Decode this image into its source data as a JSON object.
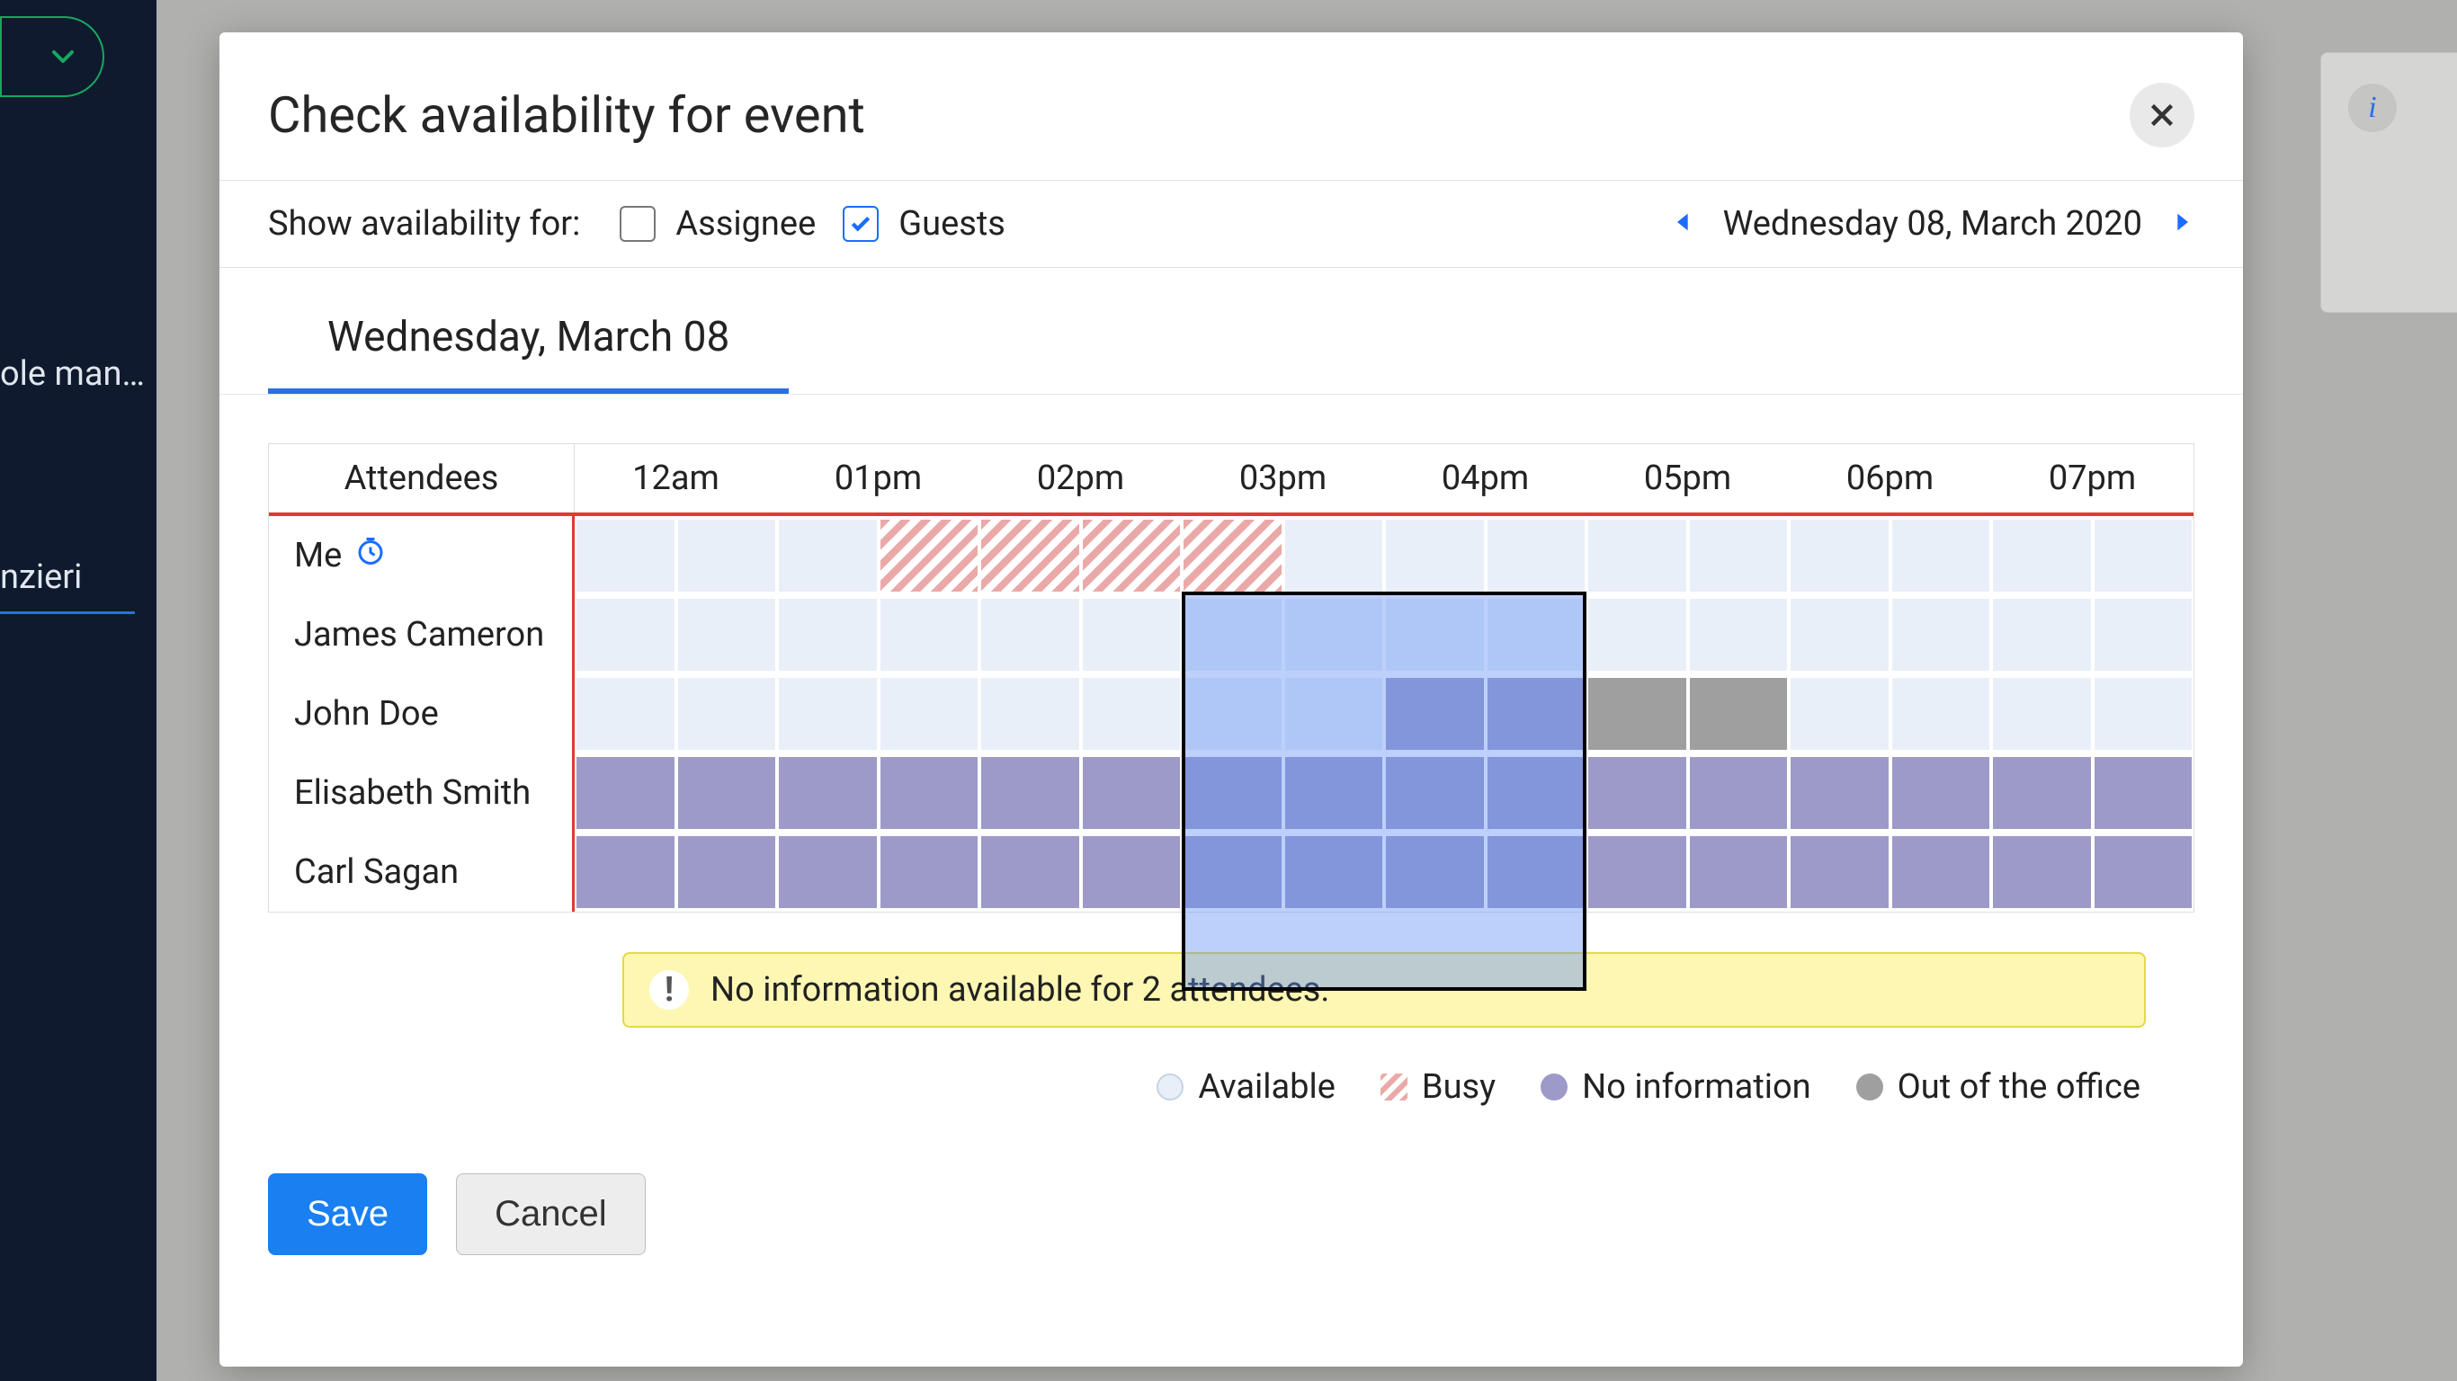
{
  "sidenav": {
    "item1_fragment": "ole man…",
    "item2_fragment": "nzieri"
  },
  "info_panel": {
    "icon": "info"
  },
  "modal": {
    "title": "Check availability for event",
    "filters": {
      "label": "Show availability for:",
      "assignee": {
        "label": "Assignee",
        "checked": false
      },
      "guests": {
        "label": "Guests",
        "checked": true
      }
    },
    "date_nav": {
      "date_long": "Wednesday 08, March 2020"
    },
    "tab": {
      "date_heading": "Wednesday, March 08"
    },
    "grid": {
      "attendees_header": "Attendees",
      "hours": [
        "12am",
        "01pm",
        "02pm",
        "03pm",
        "04pm",
        "05pm",
        "06pm",
        "07pm"
      ],
      "attendees": [
        {
          "name": "Me",
          "is_me": true,
          "cells": [
            "avail",
            "avail",
            "avail",
            "busy",
            "busy",
            "busy",
            "busy",
            "avail",
            "avail",
            "avail",
            "avail",
            "avail",
            "avail",
            "avail",
            "avail",
            "avail"
          ]
        },
        {
          "name": "James Cameron",
          "cells": [
            "avail",
            "avail",
            "avail",
            "avail",
            "avail",
            "avail",
            "avail",
            "avail",
            "avail",
            "avail",
            "avail",
            "avail",
            "avail",
            "avail",
            "avail",
            "avail"
          ]
        },
        {
          "name": "John Doe",
          "cells": [
            "avail",
            "avail",
            "avail",
            "avail",
            "avail",
            "avail",
            "avail",
            "avail",
            "noinfo",
            "noinfo",
            "out",
            "out",
            "avail",
            "avail",
            "avail",
            "avail"
          ]
        },
        {
          "name": "Elisabeth Smith",
          "cells": [
            "noinfo",
            "noinfo",
            "noinfo",
            "noinfo",
            "noinfo",
            "noinfo",
            "noinfo",
            "noinfo",
            "noinfo",
            "noinfo",
            "noinfo",
            "noinfo",
            "noinfo",
            "noinfo",
            "noinfo",
            "noinfo"
          ]
        },
        {
          "name": "Carl Sagan",
          "cells": [
            "noinfo",
            "noinfo",
            "noinfo",
            "noinfo",
            "noinfo",
            "noinfo",
            "noinfo",
            "noinfo",
            "noinfo",
            "noinfo",
            "noinfo",
            "noinfo",
            "noinfo",
            "noinfo",
            "noinfo",
            "noinfo"
          ]
        }
      ],
      "selection": {
        "start_halfhour_index": 6,
        "span_halfhours": 4
      }
    },
    "alert": {
      "text": "No information available for 2 attendees.",
      "badge": "!"
    },
    "legend": {
      "available": "Available",
      "busy": "Busy",
      "noinfo": "No information",
      "out": "Out of the office"
    },
    "buttons": {
      "save": "Save",
      "cancel": "Cancel"
    }
  }
}
